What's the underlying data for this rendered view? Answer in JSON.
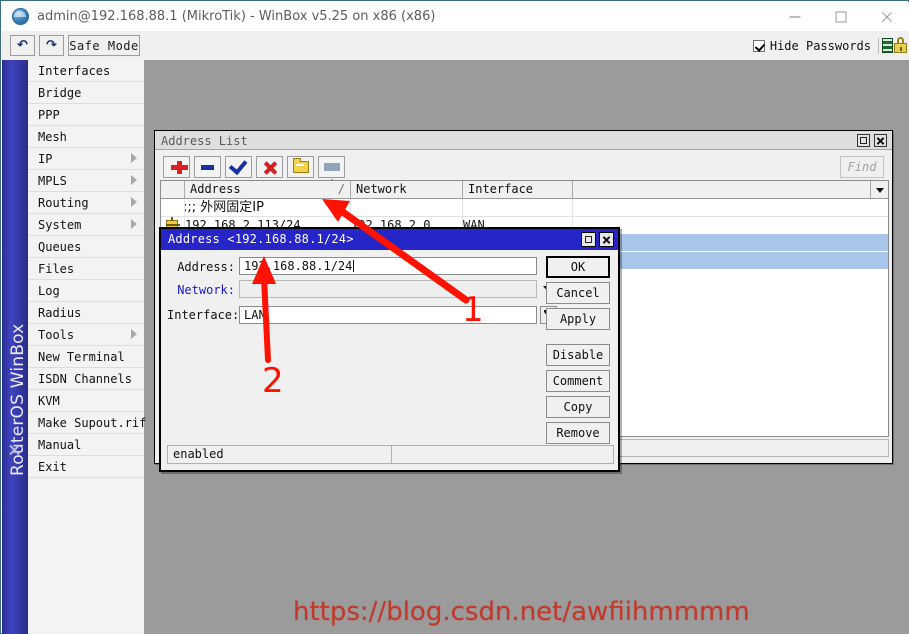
{
  "window": {
    "title": "admin@192.168.88.1 (MikroTik) - WinBox v5.25 on x86 (x86)",
    "icon": "winbox-globe-icon",
    "controls": {
      "minimize": "–",
      "maximize": "□",
      "close": "×"
    }
  },
  "toolbar": {
    "undo_label": "↶",
    "redo_label": "↷",
    "safe_mode_label": "Safe Mode",
    "hide_passwords_label": "Hide Passwords",
    "hide_passwords_checked": true,
    "memory_icon": "memory-icon",
    "lock_icon": "lock-icon"
  },
  "sidebar": {
    "vertical_label": "RouterOS WinBox",
    "items": [
      {
        "label": "Interfaces",
        "submenu": false
      },
      {
        "label": "Bridge",
        "submenu": false
      },
      {
        "label": "PPP",
        "submenu": false
      },
      {
        "label": "Mesh",
        "submenu": false
      },
      {
        "label": "IP",
        "submenu": true
      },
      {
        "label": "MPLS",
        "submenu": true
      },
      {
        "label": "Routing",
        "submenu": true
      },
      {
        "label": "System",
        "submenu": true
      },
      {
        "label": "Queues",
        "submenu": false
      },
      {
        "label": "Files",
        "submenu": false
      },
      {
        "label": "Log",
        "submenu": false
      },
      {
        "label": "Radius",
        "submenu": false
      },
      {
        "label": "Tools",
        "submenu": true
      },
      {
        "label": "New Terminal",
        "submenu": false
      },
      {
        "label": "ISDN Channels",
        "submenu": false
      },
      {
        "label": "KVM",
        "submenu": false
      },
      {
        "label": "Make Supout.rif",
        "submenu": false
      },
      {
        "label": "Manual",
        "submenu": false
      },
      {
        "label": "Exit",
        "submenu": false
      }
    ]
  },
  "address_list": {
    "title": "Address List",
    "toolbar_icons": [
      "add-icon",
      "remove-icon",
      "enable-icon",
      "disable-icon",
      "comment-icon",
      "filter-icon"
    ],
    "find_placeholder": "Find",
    "columns": [
      "",
      "Address",
      "Network",
      "Interface",
      ""
    ],
    "rows": [
      {
        "type": "comment",
        "text": ";;; 外网固定IP"
      },
      {
        "type": "entry",
        "flag": "address-flag-icon",
        "address": "192.168.2.113/24",
        "network": "192.168.2.0",
        "interface": "WAN"
      }
    ],
    "status": ""
  },
  "dialog": {
    "title": "Address <192.168.88.1/24>",
    "fields": [
      {
        "label": "Address:",
        "value": "192.168.88.1/24",
        "readonly": false,
        "dropdown": false
      },
      {
        "label": "Network:",
        "value": "",
        "readonly": true,
        "dropdown": true
      },
      {
        "label": "Interface:",
        "value": "LAN",
        "readonly": false,
        "dropdown": true
      }
    ],
    "buttons": [
      "OK",
      "Cancel",
      "Apply",
      "Disable",
      "Comment",
      "Copy",
      "Remove"
    ],
    "status": "enabled"
  },
  "annotations": [
    {
      "id": "1",
      "label": "1",
      "target": "address-field",
      "color": "#ff1200"
    },
    {
      "id": "2",
      "label": "2",
      "target": "interface-field",
      "color": "#ff1200"
    }
  ],
  "watermark": {
    "text": "https://blog.csdn.net/awfiihmmmm",
    "color": "#c0392b"
  }
}
